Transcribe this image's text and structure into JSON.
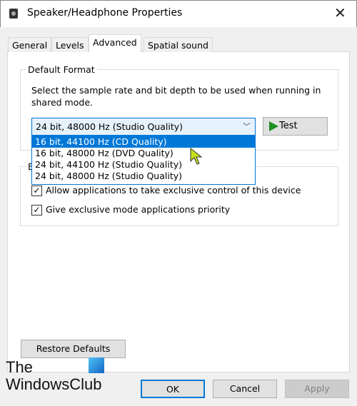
{
  "window": {
    "title": "Speaker/Headphone Properties"
  },
  "tabs": [
    {
      "label": "General"
    },
    {
      "label": "Levels"
    },
    {
      "label": "Advanced",
      "active": true
    },
    {
      "label": "Spatial sound"
    }
  ],
  "default_format": {
    "legend": "Default Format",
    "description": "Select the sample rate and bit depth to be used when running in shared mode.",
    "selected": "24 bit, 48000 Hz (Studio Quality)",
    "options": [
      "16 bit, 44100 Hz (CD Quality)",
      "16 bit, 48000 Hz (DVD Quality)",
      "24 bit, 44100 Hz (Studio Quality)",
      "24 bit, 48000 Hz (Studio Quality)"
    ],
    "highlighted_index": 0,
    "test_label": "Test"
  },
  "exclusive": {
    "legend": "E",
    "checkboxes": [
      {
        "label": "Allow applications to take exclusive control of this device",
        "checked": true
      },
      {
        "label": "Give exclusive mode applications priority",
        "checked": true
      }
    ]
  },
  "restore_label": "Restore Defaults",
  "buttons": {
    "ok": "OK",
    "cancel": "Cancel",
    "apply": "Apply"
  },
  "watermark": {
    "line1": "The",
    "line2": "WindowsClub"
  },
  "colors": {
    "accent": "#0078d7",
    "play": "#1e8e1e",
    "cursor": "#c8e01e"
  }
}
